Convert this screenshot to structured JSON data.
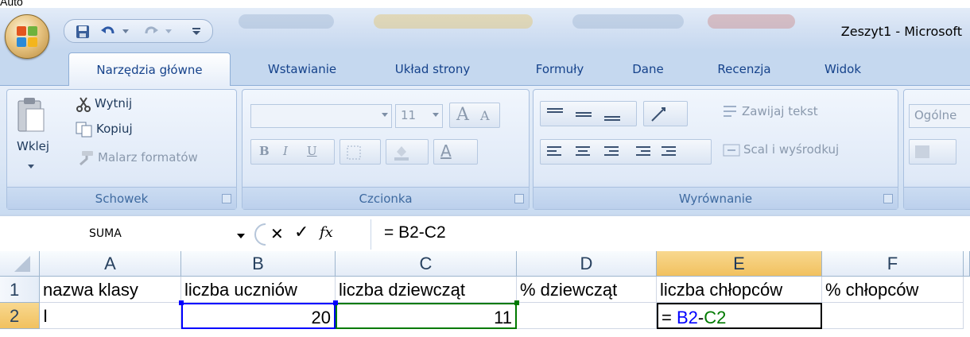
{
  "partial_text_top": "Auto",
  "window": {
    "title": "Zeszyt1 - Microsoft"
  },
  "quick_access": {
    "items": [
      "save-icon",
      "undo-icon",
      "redo-icon",
      "customize-icon"
    ]
  },
  "tabs": [
    {
      "label": "Narzędzia główne",
      "active": true
    },
    {
      "label": "Wstawianie",
      "active": false
    },
    {
      "label": "Układ strony",
      "active": false
    },
    {
      "label": "Formuły",
      "active": false
    },
    {
      "label": "Dane",
      "active": false
    },
    {
      "label": "Recenzja",
      "active": false
    },
    {
      "label": "Widok",
      "active": false
    }
  ],
  "ribbon": {
    "clipboard": {
      "label": "Schowek",
      "paste": "Wklej",
      "cut": "Wytnij",
      "copy": "Kopiuj",
      "format_painter": "Malarz formatów"
    },
    "font": {
      "label": "Czcionka",
      "font_name": "",
      "font_size": "11",
      "grow": "A",
      "shrink": "A",
      "bold": "B",
      "italic": "I",
      "underline": "U",
      "font_color": "A"
    },
    "alignment": {
      "label": "Wyrównanie",
      "wrap_text": "Zawijaj tekst",
      "merge_center": "Scal i wyśrodkuj"
    },
    "number": {
      "format": "Ogólne"
    }
  },
  "formula_bar": {
    "name_box": "SUMA",
    "cancel": "✕",
    "enter": "✓",
    "fx": "fx",
    "formula": "= B2-C2"
  },
  "sheet": {
    "columns": [
      "A",
      "B",
      "C",
      "D",
      "E",
      "F"
    ],
    "selected_column": "E",
    "rows": [
      {
        "num": "1",
        "cells": [
          "nazwa klasy",
          "liczba uczniów",
          "liczba dziewcząt",
          "% dziewcząt",
          "liczba chłopców",
          "% chłopców"
        ]
      },
      {
        "num": "2",
        "cells": [
          "I",
          "20",
          "11",
          "",
          "= B2-C2",
          ""
        ]
      }
    ],
    "active_cell_formula": {
      "prefix": "= ",
      "ref1": "B2",
      "op": "-",
      "ref2": "C2"
    }
  },
  "colors": {
    "ref_blue": "#0000ff",
    "ref_green": "#007a00",
    "accent_tab": "#15428b",
    "selected_header": "#f1c15f"
  }
}
